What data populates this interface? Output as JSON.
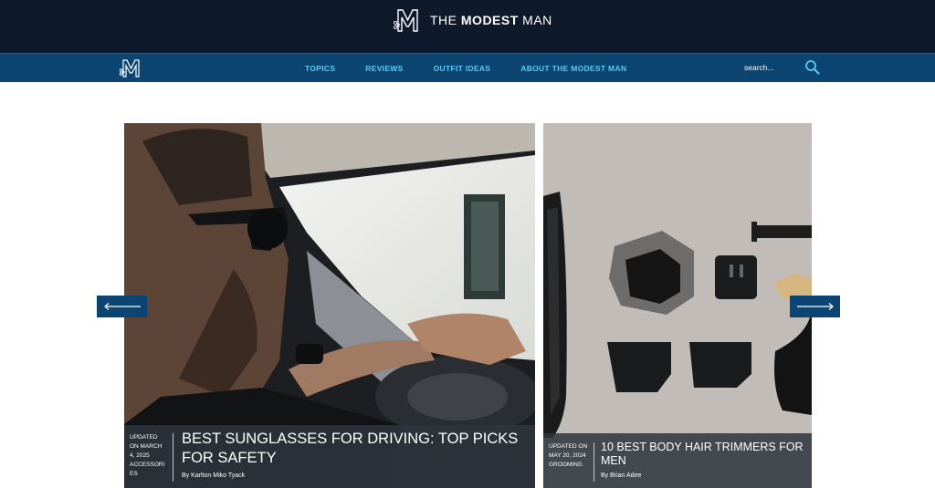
{
  "header": {
    "brand_prefix": "THE ",
    "brand_bold": "MODEST",
    "brand_suffix": " MAN"
  },
  "nav": {
    "links": [
      "TOPICS",
      "REVIEWS",
      "OUTFIT IDEAS",
      "ABOUT THE MODEST MAN"
    ],
    "search_placeholder": "search..."
  },
  "slider": {
    "cards": [
      {
        "meta": "UPDATED ON MARCH 4, 2025 ACCESSORI ES",
        "title": "BEST SUNGLASSES FOR DRIVING: TOP PICKS FOR SAFETY",
        "byline": "By Karlton Miko Tyack"
      },
      {
        "meta": "UPDATED ON MAY 20, 2024 GROOMING",
        "title": "10 BEST BODY HAIR TRIMMERS FOR MEN",
        "byline": "By Brian Adee"
      }
    ]
  },
  "colors": {
    "topbar": "#0e1a2b",
    "navbar": "#0c4572",
    "nav_link": "#5cc8f4"
  },
  "icons": {
    "logo": "modest-man-logo",
    "search": "search-icon",
    "prev": "arrow-left-icon",
    "next": "arrow-right-icon"
  }
}
